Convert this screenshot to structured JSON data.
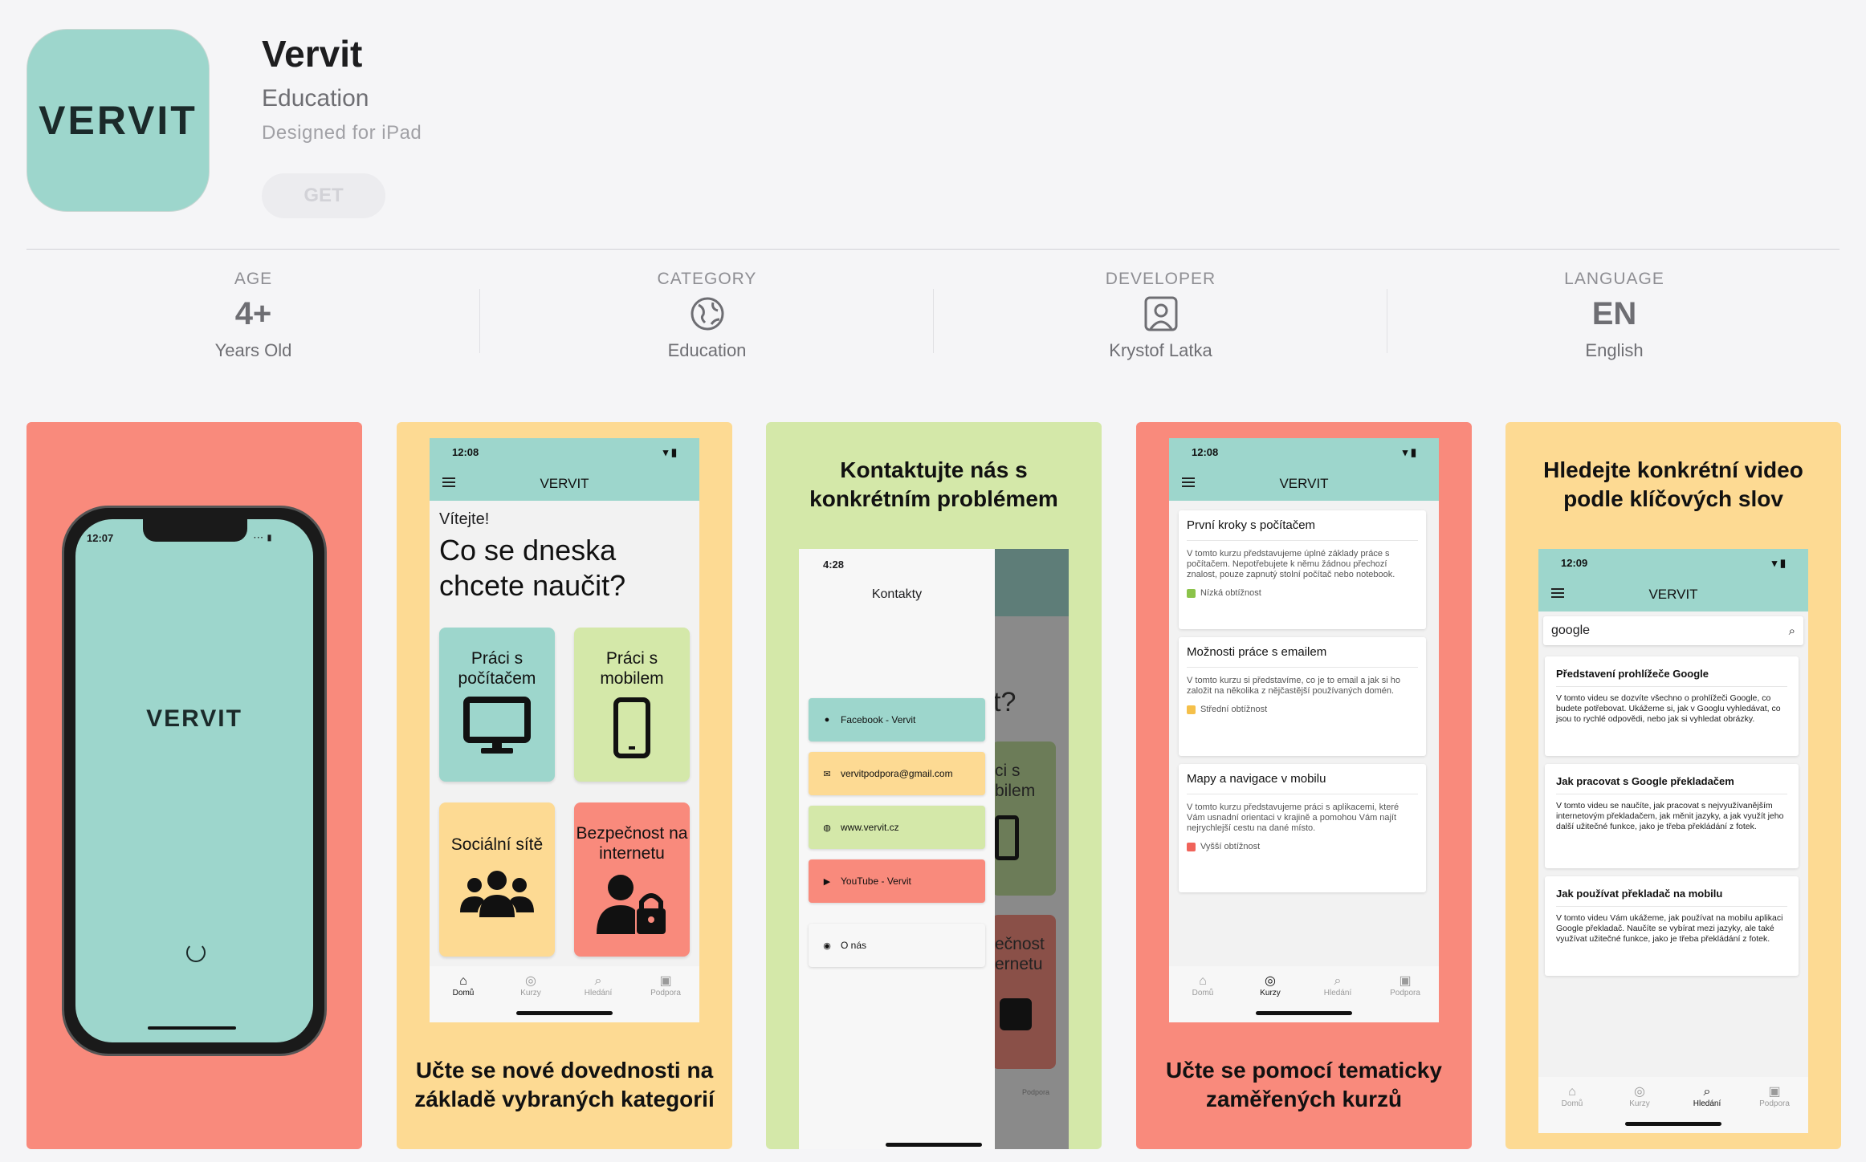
{
  "app": {
    "name": "Vervit",
    "category": "Education",
    "subtitle": "Designed for iPad",
    "get_label": "GET",
    "icon_text": "VERVIT"
  },
  "info": {
    "age": {
      "label": "AGE",
      "value": "4+",
      "sub": "Years Old"
    },
    "category": {
      "label": "CATEGORY",
      "icon": "globe-icon",
      "sub": "Education"
    },
    "developer": {
      "label": "DEVELOPER",
      "icon": "person-icon",
      "sub": "Krystof Latka"
    },
    "language": {
      "label": "LANGUAGE",
      "value": "EN",
      "sub": "English"
    }
  },
  "colors": {
    "teal": "#9dd6cc",
    "salmon": "#f98a7c",
    "yellow": "#fdda93",
    "green": "#d4e8a9"
  },
  "screenshots": {
    "s1": {
      "time": "12:07",
      "brand": "VERVIT"
    },
    "s2": {
      "time": "12:08",
      "nav_title": "VERVIT",
      "welcome": "Vítejte!",
      "heading_1": "Co se dneska",
      "heading_2": "chcete naučit?",
      "tiles": [
        {
          "label": "Práci s počítačem",
          "icon": "monitor-icon"
        },
        {
          "label": "Práci s mobilem",
          "icon": "smartphone-icon"
        },
        {
          "label": "Sociální sítě",
          "icon": "group-icon"
        },
        {
          "label": "Bezpečnost na internetu",
          "icon": "user-lock-icon"
        }
      ],
      "tabs": [
        "Domů",
        "Kurzy",
        "Hledání",
        "Podpora"
      ],
      "caption_1": "Učte se nové dovednosti na",
      "caption_2": "základě vybraných kategorií"
    },
    "s3": {
      "caption_1": "Kontaktujte nás s",
      "caption_2": "konkrétním problémem",
      "time": "4:28",
      "title": "Kontakty",
      "contacts": [
        {
          "label": "Facebook - Vervit",
          "icon": "facebook-icon"
        },
        {
          "label": "vervitpodpora@gmail.com",
          "icon": "mail-icon"
        },
        {
          "label": "www.vervit.cz",
          "icon": "globe-icon"
        },
        {
          "label": "YouTube - Vervit",
          "icon": "youtube-icon"
        },
        {
          "label": "O nás",
          "icon": "user-circle-icon"
        }
      ],
      "bg_frag_1": "t?",
      "bg_frag_2": "ci s",
      "bg_frag_3": "bilem",
      "bg_frag_4": "ečnost",
      "bg_frag_5": "ernetu",
      "bg_frag_6": "Podpora"
    },
    "s4": {
      "time": "12:08",
      "nav_title": "VERVIT",
      "courses": [
        {
          "title": "První kroky s počítačem",
          "desc": "V tomto kurzu představujeme úplné základy práce s počítačem. Nepotřebujete k němu žádnou přechozí znalost, pouze zapnutý stolní počítač nebo notebook.",
          "level": "Nízká obtížnost",
          "level_color": "#8bc34a"
        },
        {
          "title": "Možnosti práce s emailem",
          "desc": "V tomto kurzu si představíme, co je to email a jak si ho založit na několika z nějčastější používaných domén.",
          "level": "Střední obtížnost",
          "level_color": "#f5c04a"
        },
        {
          "title": "Mapy a navigace v mobilu",
          "desc": "V tomto kurzu představujeme práci s aplikacemi, které Vám usnadní orientaci v krajině a pomohou Vám najít nejrychlejší cestu na dané místo.",
          "level": "Vyšší obtížnost",
          "level_color": "#f0635a"
        }
      ],
      "tabs": [
        "Domů",
        "Kurzy",
        "Hledání",
        "Podpora"
      ],
      "caption_1": "Učte se pomocí tematicky",
      "caption_2": "zaměřených kurzů"
    },
    "s5": {
      "caption_1": "Hledejte konkrétní video",
      "caption_2": "podle klíčových slov",
      "time": "12:09",
      "nav_title": "VERVIT",
      "search_value": "google",
      "results": [
        {
          "title": "Představení prohlížeče Google",
          "desc": "V tomto videu se dozvíte všechno o prohlížeči Google, co budete potřebovat. Ukážeme si, jak v Googlu vyhledávat, co jsou to rychlé odpovědi, nebo jak si vyhledat obrázky."
        },
        {
          "title": "Jak pracovat s Google překladačem",
          "desc": "V tomto videu se naučíte, jak pracovat s nejvyužívanějším internetovým překladačem, jak měnit jazyky, a jak využít jeho další užitečné funkce, jako je třeba překládání z fotek."
        },
        {
          "title": "Jak používat překladač na mobilu",
          "desc": "V tomto videu Vám ukážeme, jak používat na mobilu aplikaci Google překladač. Naučíte se vybírat mezi jazyky, ale také využívat užitečné funkce, jako je třeba překládání z fotek."
        }
      ],
      "tabs": [
        "Domů",
        "Kurzy",
        "Hledání",
        "Podpora"
      ]
    }
  }
}
